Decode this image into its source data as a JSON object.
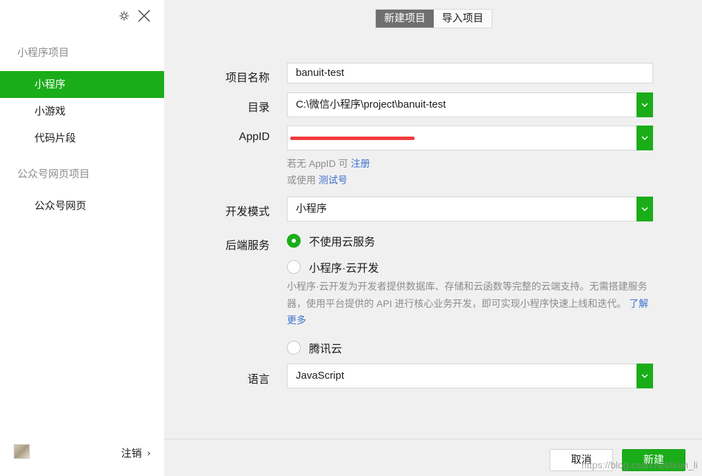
{
  "sidebar": {
    "sections": [
      {
        "title": "小程序项目",
        "items": [
          "小程序",
          "小游戏",
          "代码片段"
        ]
      },
      {
        "title": "公众号网页项目",
        "items": [
          "公众号网页"
        ]
      }
    ],
    "logout_label": "注销",
    "logout_chevron": "›"
  },
  "tabs": [
    "新建项目",
    "导入项目"
  ],
  "form": {
    "project_name_label": "项目名称",
    "project_name_value": "banuit-test",
    "directory_label": "目录",
    "directory_value": "C:\\微信小程序\\project\\banuit-test",
    "appid_label": "AppID",
    "appid_hint_prefix": "若无 AppID 可",
    "appid_hint_link": "注册",
    "appid_alt_prefix": "或使用",
    "appid_alt_link": "测试号",
    "dev_mode_label": "开发模式",
    "dev_mode_value": "小程序",
    "backend_label": "后端服务",
    "backend_options": [
      "不使用云服务",
      "小程序·云开发",
      "腾讯云"
    ],
    "backend_selected_index": 0,
    "cloud_desc": "小程序·云开发为开发者提供数据库、存储和云函数等完整的云端支持。无需搭建服务器，使用平台提供的 API 进行核心业务开发，即可实现小程序快速上线和迭代。",
    "cloud_desc_link": "了解更多",
    "language_label": "语言",
    "language_value": "JavaScript"
  },
  "footer": {
    "cancel_label": "取消",
    "create_label": "新建",
    "watermark": "https://blog.csdn.net/ikun_li"
  },
  "colors": {
    "accent": "#1aad19",
    "active_tab": "#6f6f6f",
    "link": "#3d6fcc",
    "redaction": "#f03a3a"
  },
  "icons": {
    "settings": "gear-icon",
    "close": "close-icon",
    "dropdown": "chevron-down-icon",
    "logout": "chevron-right-icon"
  }
}
